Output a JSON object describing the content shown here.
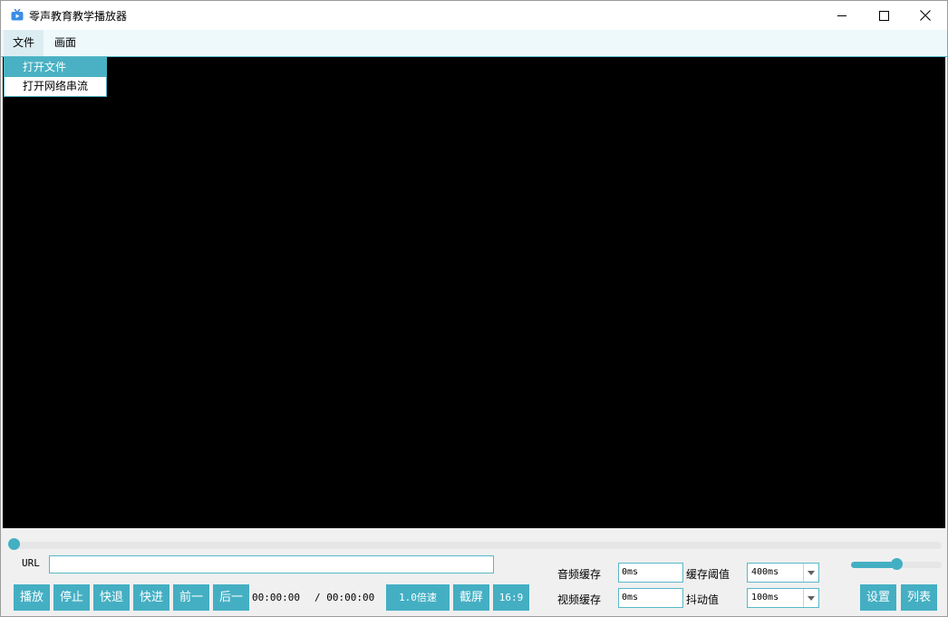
{
  "window": {
    "title": "零声教育教学播放器",
    "controls": [
      "minimize-icon",
      "maximize-icon",
      "close-icon"
    ]
  },
  "menubar": {
    "items": [
      {
        "label": "文件",
        "active": true
      },
      {
        "label": "画面",
        "active": false
      }
    ]
  },
  "file_menu": {
    "items": [
      "打开文件",
      "打开网络串流"
    ],
    "highlighted": 0
  },
  "player": {
    "progress_fraction": 0.0,
    "url_label": "URL",
    "url_value": "",
    "buttons": [
      "播放",
      "停止",
      "快退",
      "快进",
      "前一",
      "后一"
    ],
    "current_time": "00:00:00",
    "total_time": "/ 00:00:00",
    "speed_button": "1.0倍速",
    "screenshot_button": "截屏",
    "aspect_button": "16:9"
  },
  "buffer": {
    "audio_label": "音频缓存",
    "audio_value": "0ms",
    "video_label": "视频缓存",
    "video_value": "0ms",
    "threshold_label": "缓存阈值",
    "threshold_value": "400ms",
    "jitter_label": "抖动值",
    "jitter_value": "100ms"
  },
  "volume": {
    "fraction": 0.5
  },
  "side_buttons": {
    "settings": "设置",
    "list": "列表"
  },
  "colors": {
    "accent": "#44afc3",
    "menubar_bg": "#eef9fb",
    "video_bg": "#000000"
  }
}
